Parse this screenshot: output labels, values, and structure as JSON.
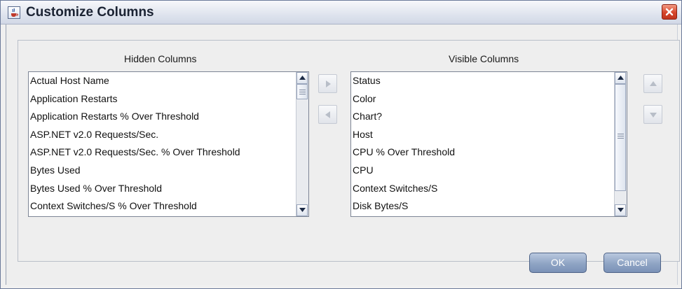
{
  "window": {
    "title": "Customize Columns"
  },
  "hidden": {
    "header": "Hidden Columns",
    "items": [
      "Actual Host Name",
      "Application Restarts",
      "Application Restarts % Over Threshold",
      "ASP.NET v2.0 Requests/Sec.",
      "ASP.NET v2.0 Requests/Sec. % Over Threshold",
      "Bytes Used",
      "Bytes Used % Over Threshold",
      "Context Switches/S % Over Threshold"
    ]
  },
  "visible": {
    "header": "Visible Columns",
    "items": [
      "Status",
      "Color",
      "Chart?",
      "Host",
      "CPU % Over Threshold",
      "CPU",
      "Context Switches/S",
      "Disk Bytes/S"
    ]
  },
  "buttons": {
    "ok": "OK",
    "cancel": "Cancel"
  },
  "icons": {
    "app": "java-cup-icon",
    "close": "close-icon",
    "move_right": "arrow-right-icon",
    "move_left": "arrow-left-icon",
    "move_up": "arrow-up-icon",
    "move_down": "arrow-down-icon"
  },
  "colors": {
    "close_red": "#d6452b",
    "button_blue": "#8fa4c4",
    "title_bg": "#dfe4ee"
  }
}
